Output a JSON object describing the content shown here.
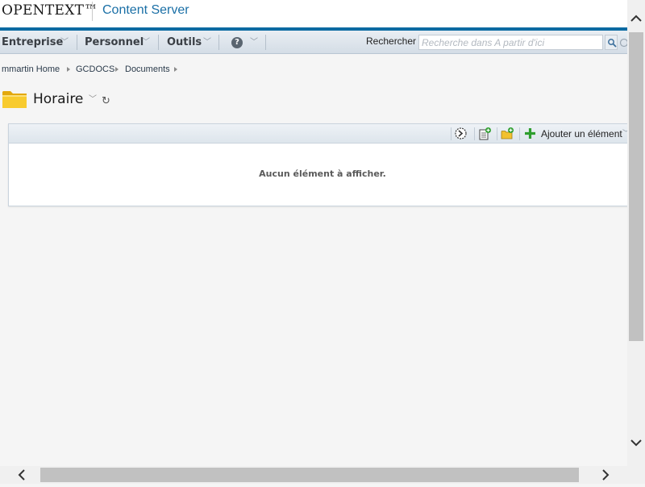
{
  "header": {
    "logo_text": "OPENTEXT™",
    "product_name": "Content Server"
  },
  "nav": {
    "items": [
      {
        "label": "Entreprise"
      },
      {
        "label": "Personnel"
      },
      {
        "label": "Outils"
      }
    ],
    "help_icon": "help-circle-icon",
    "search_label": "Rechercher",
    "search_placeholder": "Recherche dans A partir d'ici"
  },
  "breadcrumb": [
    {
      "label": "mmartin Home"
    },
    {
      "label": "GCDOCS"
    },
    {
      "label": "Documents"
    }
  ],
  "page": {
    "title": "Horaire",
    "folder_icon": "folder-icon",
    "refresh_icon": "refresh-icon"
  },
  "panel": {
    "toolbar": {
      "icons": [
        "clock-refresh-icon",
        "add-document-icon",
        "add-folder-icon",
        "plus-icon"
      ],
      "add_item_label": "Ajouter un élément"
    },
    "empty_message": "Aucun élément à afficher."
  },
  "colors": {
    "brand_blue": "#0b6aa2",
    "product_text": "#1a6fa6",
    "navbar_bg": "#d4dde6"
  }
}
